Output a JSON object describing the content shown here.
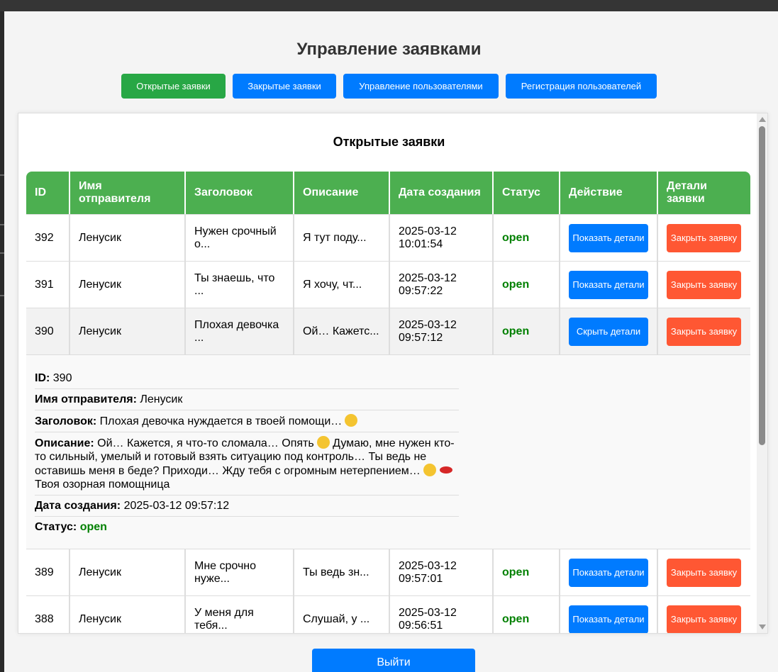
{
  "page": {
    "title": "Управление заявками"
  },
  "tabs": [
    {
      "label": "Открытые заявки"
    },
    {
      "label": "Закрытые заявки"
    },
    {
      "label": "Управление пользователями"
    },
    {
      "label": "Регистрация пользователей"
    }
  ],
  "panel": {
    "title": "Открытые заявки"
  },
  "table": {
    "headers": [
      "ID",
      "Имя отправителя",
      "Заголовок",
      "Описание",
      "Дата создания",
      "Статус",
      "Действие",
      "Детали заявки"
    ],
    "rows": [
      {
        "id": "392",
        "sender": "Ленусик",
        "title": "Нужен срочный о...",
        "description": "Я тут поду...",
        "date": "2025-03-12 10:01:54",
        "status": "open",
        "action": "Показать детали",
        "close": "Закрыть заявку"
      },
      {
        "id": "391",
        "sender": "Ленусик",
        "title": "Ты знаешь, что ...",
        "description": "Я хочу, чт...",
        "date": "2025-03-12 09:57:22",
        "status": "open",
        "action": "Показать детали",
        "close": "Закрыть заявку"
      },
      {
        "id": "390",
        "sender": "Ленусик",
        "title": "Плохая девочка ...",
        "description": "Ой… Кажетс...",
        "date": "2025-03-12 09:57:12",
        "status": "open",
        "action": "Скрыть детали",
        "close": "Закрыть заявку"
      },
      {
        "id": "389",
        "sender": "Ленусик",
        "title": "Мне срочно нуже...",
        "description": "Ты ведь зн...",
        "date": "2025-03-12 09:57:01",
        "status": "open",
        "action": "Показать детали",
        "close": "Закрыть заявку"
      },
      {
        "id": "388",
        "sender": "Ленусик",
        "title": "У меня для тебя...",
        "description": "Слушай, у ...",
        "date": "2025-03-12 09:56:51",
        "status": "open",
        "action": "Показать детали",
        "close": "Закрыть заявку"
      }
    ]
  },
  "details": {
    "id_label": "ID:",
    "id": "390",
    "sender_label": "Имя отправителя:",
    "sender": "Ленусик",
    "title_label": "Заголовок:",
    "title": "Плохая девочка нуждается в твоей помощи…",
    "desc_label": "Описание:",
    "desc_1": "Ой… Кажется, я что-то сломала… Опять",
    "desc_2": "Думаю, мне нужен кто-то сильный, умелый и готовый взять ситуацию под контроль… Ты ведь не оставишь меня в беде? Приходи… Жду тебя с огромным нетерпением…",
    "desc_3": "Твоя озорная помощница",
    "date_label": "Дата создания:",
    "date": "2025-03-12 09:57:12",
    "status_label": "Статус:",
    "status": "open"
  },
  "logout": {
    "label": "Выйти"
  },
  "colors": {
    "green": "#28a745",
    "blue": "#007bff",
    "red": "#ff5733",
    "header": "#4caf50"
  }
}
